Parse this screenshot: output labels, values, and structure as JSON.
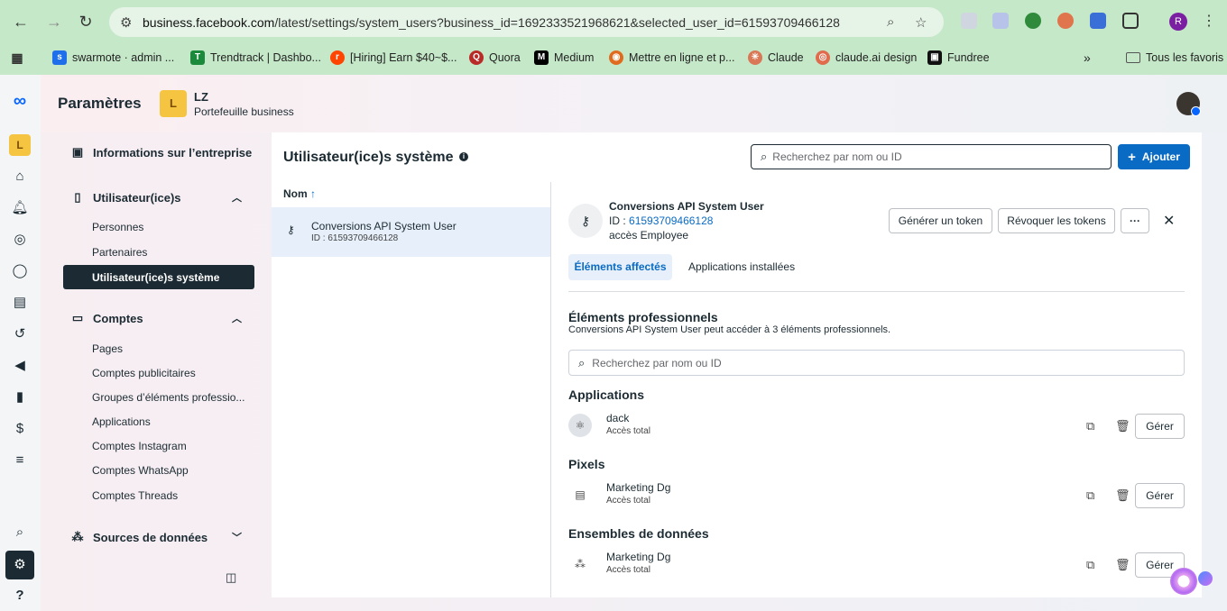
{
  "browser": {
    "url_host": "business.facebook.com",
    "url_path": "/latest/settings/system_users?business_id=1692333521968621&selected_user_id=61593709466128",
    "profile_initial": "R",
    "bookmarks": [
      {
        "label": "swarmote · admin ..."
      },
      {
        "label": "Trendtrack | Dashbo..."
      },
      {
        "label": "[Hiring] Earn $40~$..."
      },
      {
        "label": "Quora"
      },
      {
        "label": "Medium"
      },
      {
        "label": "Mettre en ligne et p..."
      },
      {
        "label": "Claude"
      },
      {
        "label": "claude.ai design"
      },
      {
        "label": "Fundree"
      }
    ],
    "all_bookmarks": "Tous les favoris"
  },
  "header": {
    "title": "Paramètres",
    "business_initial": "L",
    "business_name": "LZ",
    "business_type": "Portefeuille business"
  },
  "rail": {
    "business_initial": "L",
    "help": "?"
  },
  "sidebar": {
    "info": "Informations sur l’entreprise",
    "users": "Utilisateur(ice)s",
    "people": "Personnes",
    "partners": "Partenaires",
    "system_users": "Utilisateur(ice)s système",
    "accounts": "Comptes",
    "pages": "Pages",
    "ad_accounts": "Comptes publicitaires",
    "groups": "Groupes d’éléments professio...",
    "apps": "Applications",
    "instagram": "Comptes Instagram",
    "whatsapp": "Comptes WhatsApp",
    "threads": "Comptes Threads",
    "data_sources": "Sources de données"
  },
  "panel": {
    "title": "Utilisateur(ice)s système",
    "search_placeholder": "Recherchez par nom ou ID",
    "add_label": "Ajouter",
    "col_name": "Nom",
    "list": [
      {
        "name": "Conversions API System User",
        "id": "ID : 61593709466128"
      }
    ]
  },
  "detail": {
    "name": "Conversions API System User",
    "id_label": "ID : ",
    "id_value": "61593709466128",
    "access": "accès Employee",
    "gen_token": "Générer un token",
    "revoke_tokens": "Révoquer les tokens",
    "more": "···",
    "tabs": {
      "assigned": "Éléments affectés",
      "installed": "Applications installées"
    },
    "section_title": "Éléments professionnels",
    "section_desc": "Conversions API System User peut accéder à 3 éléments professionnels.",
    "search_placeholder": "Recherchez par nom ou ID",
    "manage": "Gérer",
    "applications_title": "Applications",
    "app_name": "dack",
    "app_access": "Accès total",
    "pixels_title": "Pixels",
    "pixel_name": "Marketing Dg",
    "pixel_access": "Accès total",
    "datasets_title": "Ensembles de données",
    "dataset_name": "Marketing Dg",
    "dataset_access": "Accès total"
  },
  "colors": {
    "chrome": "#c5e8c9",
    "accent": "#0a6bc4",
    "active_nav": "#1c2b33"
  }
}
